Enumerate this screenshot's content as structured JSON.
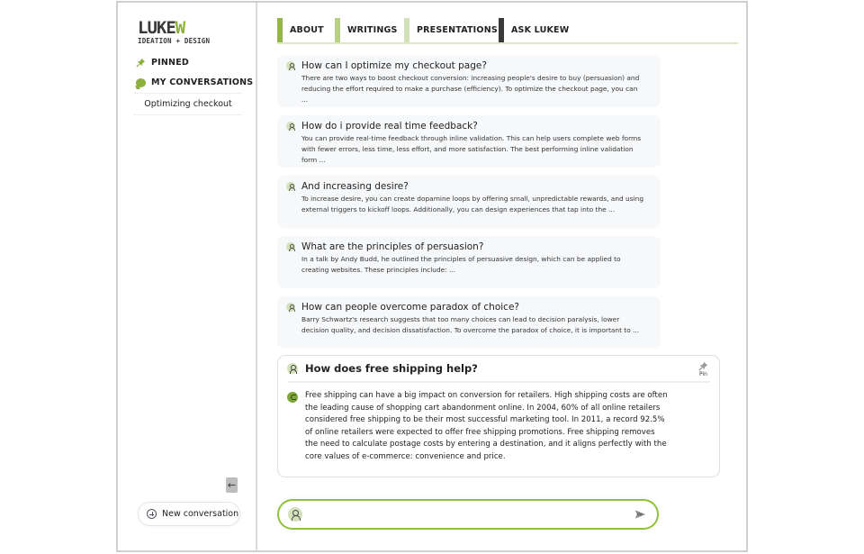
{
  "brand": {
    "logo_main_dark": "LUKE",
    "logo_main_green": "W",
    "logo_sub": "IDEATION + DESIGN",
    "accent_color": "#8db03a"
  },
  "sidebar": {
    "pinned_label": "PINNED",
    "conversations_label": "MY CONVERSATIONS",
    "conversations": [
      {
        "title": "Optimizing checkout"
      }
    ],
    "collapse_icon": "←",
    "new_conversation_label": "New conversation"
  },
  "tabs": [
    {
      "label": "ABOUT"
    },
    {
      "label": "WRITINGS"
    },
    {
      "label": "PRESENTATIONS"
    },
    {
      "label": "ASK LUKEW",
      "active": true
    }
  ],
  "history": [
    {
      "question": "How can I optimize my checkout page?",
      "answer": "There are two ways to boost checkout conversion: increasing people's desire to buy (persuasion) and reducing the effort required to make a purchase (efficiency). To optimize the checkout page, you can ..."
    },
    {
      "question": "How do i provide real time feedback?",
      "answer": "You can provide real-time feedback through inline validation. This can help users complete web forms with fewer errors, less time, less effort, and more satisfaction. The best performing inline validation form ..."
    },
    {
      "question": "And increasing desire?",
      "answer": "To increase desire, you can create dopamine loops by offering small, unpredictable rewards, and using external triggers to kickoff loops. Additionally, you can design experiences that tap into the ..."
    },
    {
      "question": "What are the principles of persuasion?",
      "answer": "In a talk by Andy Budd, he outlined the principles of persuasive design, which can be applied to creating websites. These principles include: ..."
    },
    {
      "question": "How can people overcome paradox of choice?",
      "answer": "Barry Schwartz's research suggests that too many choices can lead to decision paralysis, lower decision quality, and decision dissatisfaction. To overcome the paradox of choice, it is important to ..."
    }
  ],
  "active": {
    "question": "How does free shipping help?",
    "pin_label": "Pin",
    "answer": "Free shipping can have a big impact on conversion for retailers. High shipping costs are often the leading cause of shopping cart abandonment online. In 2004, 60% of all online retailers considered free shipping to be their most successful marketing tool. In 2011, a record 92.5% of online retailers were expected to offer free shipping promotions. Free shipping removes the need to calculate postage costs by entering a destination, and it aligns perfectly with the core values of e-commerce: convenience and price."
  },
  "composer": {
    "value": "",
    "placeholder": ""
  }
}
